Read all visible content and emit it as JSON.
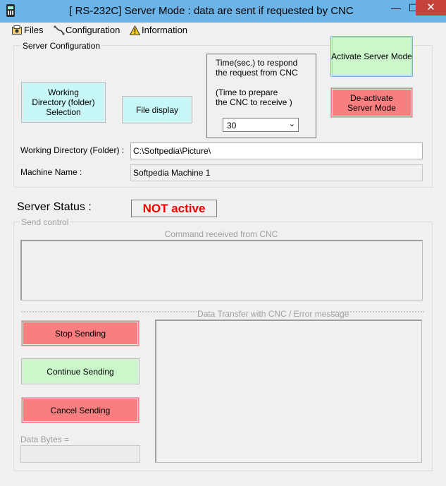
{
  "window": {
    "title": "[ RS-232C]  Server Mode : data are sent if requested by CNC",
    "minimize": "—",
    "maximize": "☐",
    "close": "✕"
  },
  "menu": [
    {
      "label": "Files",
      "icon": "files-icon"
    },
    {
      "label": "Configuration",
      "icon": "configuration-icon"
    },
    {
      "label": "Information",
      "icon": "warning-icon"
    }
  ],
  "server_config": {
    "legend": "Server Configuration",
    "working_dir_button": "Working Directory (folder) Selection",
    "file_display_button": "File display",
    "time_box": {
      "line1": "Time(sec.) to respond",
      "line2": "the request from CNC",
      "line3": "(Time to prepare",
      "line4": "the CNC to receive )",
      "selected": "30"
    },
    "activate_button": "Activate Server Mode",
    "deactivate_button": "De-activate Server Mode",
    "working_dir_label": "Working Directory (Folder) :",
    "working_dir_value": "C:\\Softpedia\\Picture\\",
    "machine_label": "Machine Name :",
    "machine_value": "Softpedia Machine 1"
  },
  "status": {
    "label": "Server Status :",
    "value": "NOT active",
    "value_color": "#ee0000"
  },
  "send_control": {
    "legend": "Send control",
    "command_label": "Command received from CNC",
    "transfer_label": "Data Transfer with CNC / Error message",
    "stop_button": "Stop Sending",
    "continue_button": "Continue Sending",
    "cancel_button": "Cancel Sending",
    "data_bytes_label": "Data Bytes ="
  },
  "colors": {
    "cyan": "#c8f7f7",
    "green": "#cbf7cb",
    "red": "#f87f7f",
    "titlebar": "#6cb4e8",
    "close": "#c7423a"
  }
}
